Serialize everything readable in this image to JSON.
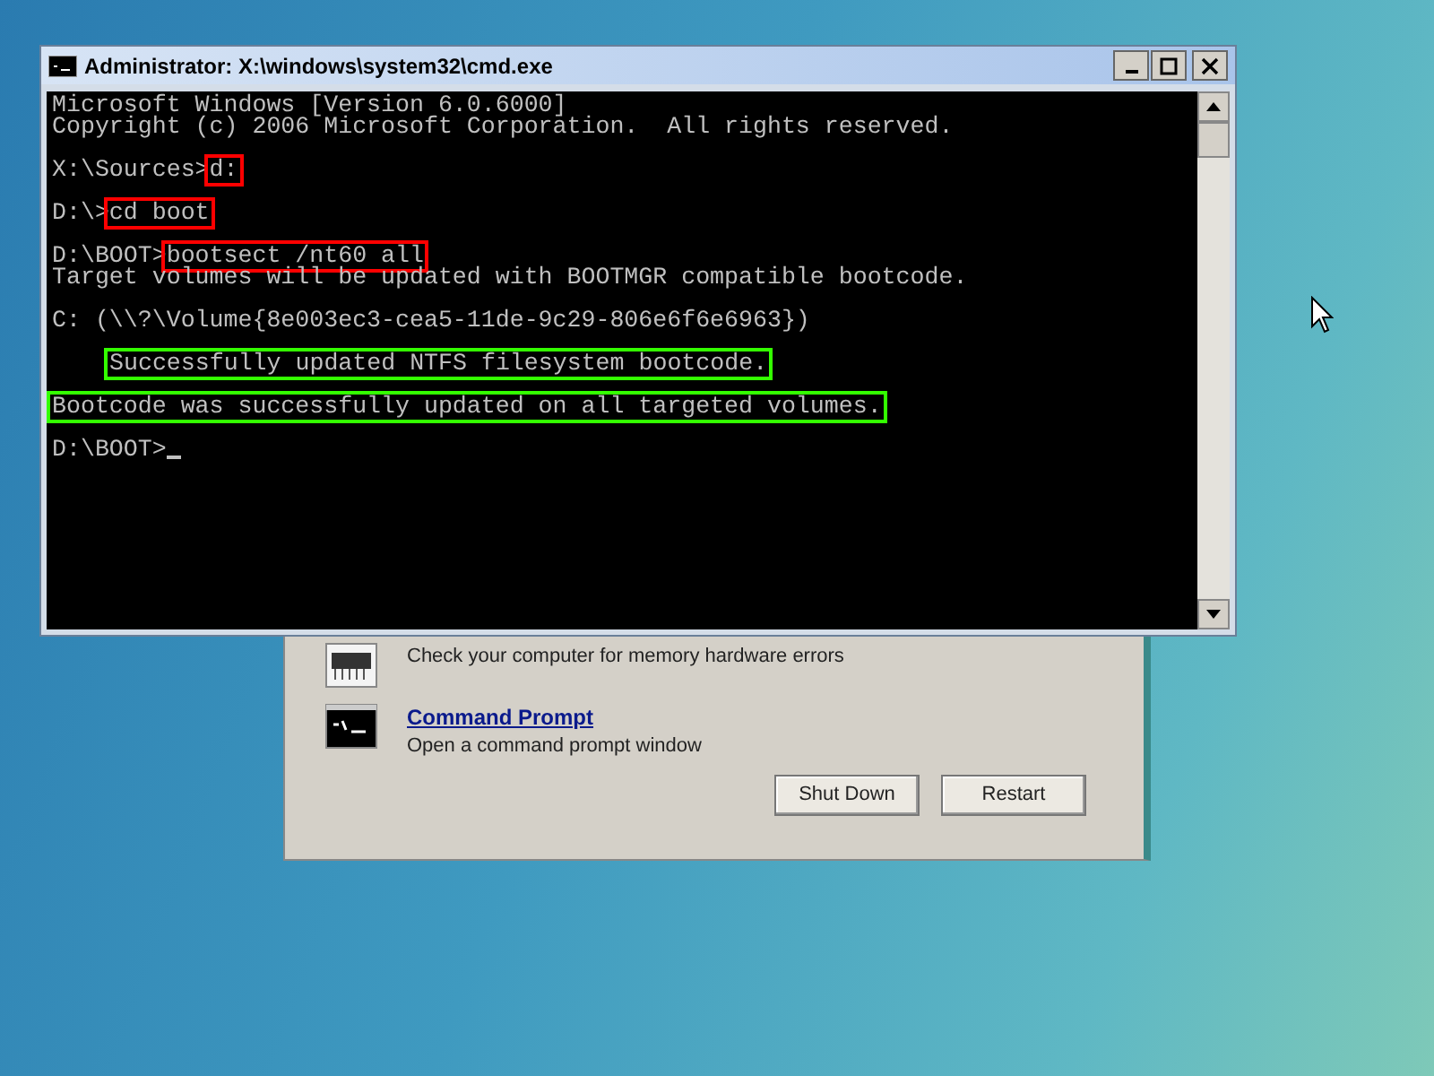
{
  "recovery_dialog": {
    "items": [
      {
        "kind": "covered",
        "description": "Check your computer for memory hardware errors"
      },
      {
        "kind": "link",
        "title": "Command Prompt",
        "description": "Open a command prompt window"
      }
    ],
    "buttons": [
      "Shut Down",
      "Restart"
    ]
  },
  "console": {
    "title": "Administrator: X:\\windows\\system32\\cmd.exe",
    "lines": [
      {
        "kind": "text",
        "parts": [
          {
            "text": "Microsoft Windows [Version 6.0.6000]"
          }
        ]
      },
      {
        "kind": "text",
        "parts": [
          {
            "text": "Copyright (c) 2006 Microsoft Corporation.  All rights reserved."
          }
        ]
      },
      {
        "kind": "blank"
      },
      {
        "kind": "text",
        "parts": [
          {
            "text": "X:\\Sources>"
          },
          {
            "text": "d:",
            "color": "#ff0000"
          }
        ]
      },
      {
        "kind": "blank"
      },
      {
        "kind": "text",
        "parts": [
          {
            "text": "D:\\>"
          },
          {
            "text": "cd boot",
            "color": "#ff0000"
          }
        ]
      },
      {
        "kind": "blank"
      },
      {
        "kind": "text",
        "parts": [
          {
            "text": "D:\\BOOT>"
          },
          {
            "text": "bootsect /nt60 all",
            "color": "#ff0000"
          }
        ]
      },
      {
        "kind": "text",
        "parts": [
          {
            "text": "Target volumes will be updated with BOOTMGR compatible bootcode."
          }
        ]
      },
      {
        "kind": "blank"
      },
      {
        "kind": "text",
        "parts": [
          {
            "text": "C: (\\\\?\\Volume{8e003ec3-cea5-11de-9c29-806e6f6e6963})"
          }
        ]
      },
      {
        "kind": "blank"
      },
      {
        "kind": "text",
        "indent": true,
        "parts": [
          {
            "text": "Successfully updated NTFS filesystem bootcode.",
            "color": "#33ff00"
          }
        ]
      },
      {
        "kind": "blank"
      },
      {
        "kind": "text",
        "parts": [
          {
            "text": "Bootcode was successfully updated on all targeted volumes.",
            "color": "#33ff00"
          }
        ]
      },
      {
        "kind": "blank"
      },
      {
        "kind": "text",
        "cursor": true,
        "parts": [
          {
            "text": "D:\\BOOT>"
          }
        ]
      }
    ]
  }
}
